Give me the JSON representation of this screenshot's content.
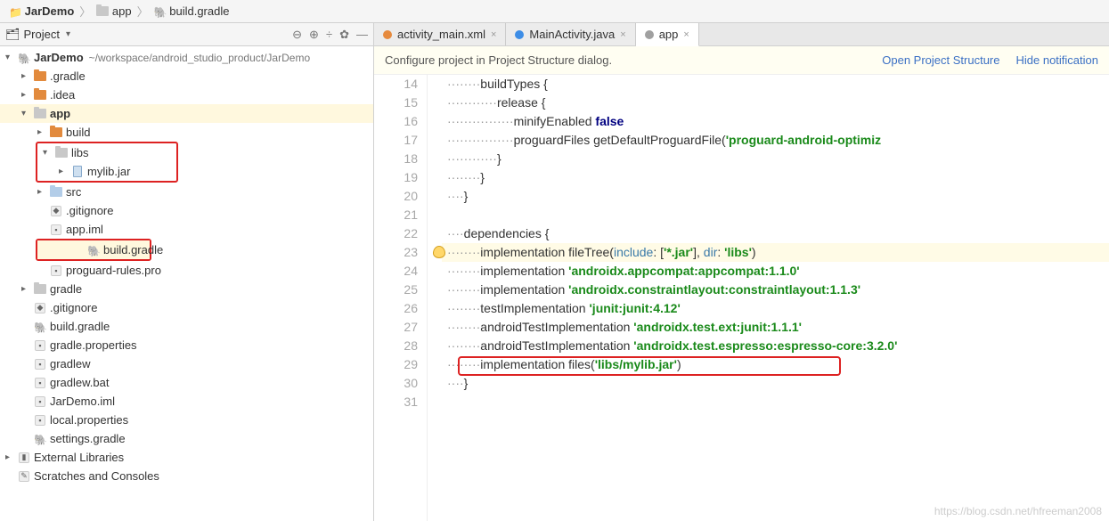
{
  "breadcrumb": {
    "items": [
      "JarDemo",
      "app",
      "build.gradle"
    ]
  },
  "projectPane": {
    "title": "Project",
    "actions": {
      "collapse": "⊖",
      "target": "⊕",
      "divide": "÷",
      "gear": "✿",
      "hide": "—"
    }
  },
  "tree": [
    {
      "depth": 0,
      "chev": "▾",
      "iconType": "gradle",
      "label": "JarDemo",
      "path": "~/workspace/android_studio_product/JarDemo",
      "bold": true
    },
    {
      "depth": 1,
      "chev": "▸",
      "iconType": "folder-orange",
      "label": ".gradle"
    },
    {
      "depth": 1,
      "chev": "▸",
      "iconType": "folder-orange",
      "label": ".idea"
    },
    {
      "depth": 1,
      "chev": "▾",
      "iconType": "folder-gray",
      "label": "app",
      "selected": true,
      "bold": true
    },
    {
      "depth": 2,
      "chev": "▸",
      "iconType": "folder-orange",
      "label": "build"
    },
    {
      "depth": 2,
      "chev": "▾",
      "iconType": "folder-gray",
      "label": "libs",
      "boxStart": true
    },
    {
      "depth": 3,
      "chev": "▸",
      "iconType": "jar",
      "label": "mylib.jar",
      "boxEnd": true
    },
    {
      "depth": 2,
      "chev": "▸",
      "iconType": "folder-src",
      "label": "src"
    },
    {
      "depth": 2,
      "chev": "",
      "iconType": "gitignore",
      "label": ".gitignore"
    },
    {
      "depth": 2,
      "chev": "",
      "iconType": "gen",
      "label": "app.iml"
    },
    {
      "depth": 2,
      "chev": "",
      "iconType": "gradle",
      "label": "build.gradle",
      "selected": true,
      "boxSingle": true
    },
    {
      "depth": 2,
      "chev": "",
      "iconType": "gen",
      "label": "proguard-rules.pro"
    },
    {
      "depth": 1,
      "chev": "▸",
      "iconType": "folder-gray",
      "label": "gradle"
    },
    {
      "depth": 1,
      "chev": "",
      "iconType": "gitignore",
      "label": ".gitignore"
    },
    {
      "depth": 1,
      "chev": "",
      "iconType": "gradle",
      "label": "build.gradle"
    },
    {
      "depth": 1,
      "chev": "",
      "iconType": "gen",
      "label": "gradle.properties"
    },
    {
      "depth": 1,
      "chev": "",
      "iconType": "gen",
      "label": "gradlew"
    },
    {
      "depth": 1,
      "chev": "",
      "iconType": "gen",
      "label": "gradlew.bat"
    },
    {
      "depth": 1,
      "chev": "",
      "iconType": "gen",
      "label": "JarDemo.iml"
    },
    {
      "depth": 1,
      "chev": "",
      "iconType": "gen",
      "label": "local.properties"
    },
    {
      "depth": 1,
      "chev": "",
      "iconType": "gradle",
      "label": "settings.gradle"
    },
    {
      "depth": 0,
      "chev": "▸",
      "iconType": "lib",
      "label": "External Libraries"
    },
    {
      "depth": 0,
      "chev": "",
      "iconType": "scratch",
      "label": "Scratches and Consoles"
    }
  ],
  "tabs": [
    {
      "label": "activity_main.xml",
      "icon": "xml",
      "active": false
    },
    {
      "label": "MainActivity.java",
      "icon": "java",
      "active": false
    },
    {
      "label": "app",
      "icon": "gradle",
      "active": true
    }
  ],
  "infoBar": {
    "message": "Configure project in Project Structure dialog.",
    "link1": "Open Project Structure",
    "link2": "Hide notification"
  },
  "code": {
    "startLine": 14,
    "currentLine": 23,
    "lines": [
      {
        "n": 14,
        "parts": [
          {
            "t": "        ",
            "c": ""
          },
          {
            "t": "buildTypes {",
            "c": ""
          }
        ]
      },
      {
        "n": 15,
        "parts": [
          {
            "t": "            ",
            "c": ""
          },
          {
            "t": "release {",
            "c": ""
          }
        ]
      },
      {
        "n": 16,
        "parts": [
          {
            "t": "                ",
            "c": ""
          },
          {
            "t": "minifyEnabled ",
            "c": ""
          },
          {
            "t": "false",
            "c": "tok-bool"
          }
        ]
      },
      {
        "n": 17,
        "parts": [
          {
            "t": "                ",
            "c": ""
          },
          {
            "t": "proguardFiles getDefaultProguardFile(",
            "c": ""
          },
          {
            "t": "'proguard-android-optimiz",
            "c": "tok-str"
          }
        ]
      },
      {
        "n": 18,
        "parts": [
          {
            "t": "            }",
            "c": ""
          }
        ]
      },
      {
        "n": 19,
        "parts": [
          {
            "t": "        }",
            "c": ""
          }
        ]
      },
      {
        "n": 20,
        "parts": [
          {
            "t": "    }",
            "c": ""
          }
        ]
      },
      {
        "n": 21,
        "parts": [
          {
            "t": "",
            "c": ""
          }
        ]
      },
      {
        "n": 22,
        "parts": [
          {
            "t": "    ",
            "c": ""
          },
          {
            "t": "dependencies {",
            "c": ""
          }
        ]
      },
      {
        "n": 23,
        "parts": [
          {
            "t": "        ",
            "c": ""
          },
          {
            "t": "implementation fileTree(",
            "c": ""
          },
          {
            "t": "include",
            "c": "tok-id"
          },
          {
            "t": ": [",
            "c": ""
          },
          {
            "t": "'*.jar'",
            "c": "tok-str"
          },
          {
            "t": "], ",
            "c": ""
          },
          {
            "t": "dir",
            "c": "tok-id"
          },
          {
            "t": ": ",
            "c": ""
          },
          {
            "t": "'libs'",
            "c": "tok-str"
          },
          {
            "t": ")",
            "c": ""
          }
        ]
      },
      {
        "n": 24,
        "parts": [
          {
            "t": "        ",
            "c": ""
          },
          {
            "t": "implementation ",
            "c": ""
          },
          {
            "t": "'androidx.appcompat:appcompat:1.1.0'",
            "c": "tok-str"
          }
        ]
      },
      {
        "n": 25,
        "parts": [
          {
            "t": "        ",
            "c": ""
          },
          {
            "t": "implementation ",
            "c": ""
          },
          {
            "t": "'androidx.constraintlayout:constraintlayout:1.1.3'",
            "c": "tok-str"
          }
        ]
      },
      {
        "n": 26,
        "parts": [
          {
            "t": "        ",
            "c": ""
          },
          {
            "t": "testImplementation ",
            "c": ""
          },
          {
            "t": "'junit:junit:4.12'",
            "c": "tok-str"
          }
        ]
      },
      {
        "n": 27,
        "parts": [
          {
            "t": "        ",
            "c": ""
          },
          {
            "t": "androidTestImplementation ",
            "c": ""
          },
          {
            "t": "'androidx.test.ext:junit:1.1.1'",
            "c": "tok-str"
          }
        ]
      },
      {
        "n": 28,
        "parts": [
          {
            "t": "        ",
            "c": ""
          },
          {
            "t": "androidTestImplementation ",
            "c": ""
          },
          {
            "t": "'androidx.test.espresso:espresso-core:3.2.0'",
            "c": "tok-str"
          }
        ]
      },
      {
        "n": 29,
        "parts": [
          {
            "t": "        ",
            "c": ""
          },
          {
            "t": "implementation files(",
            "c": ""
          },
          {
            "t": "'libs/mylib.jar'",
            "c": "tok-str"
          },
          {
            "t": ")",
            "c": ""
          }
        ]
      },
      {
        "n": 30,
        "parts": [
          {
            "t": "    }",
            "c": ""
          }
        ]
      },
      {
        "n": 31,
        "parts": [
          {
            "t": "",
            "c": ""
          }
        ]
      }
    ]
  },
  "watermark": "https://blog.csdn.net/hfreeman2008"
}
